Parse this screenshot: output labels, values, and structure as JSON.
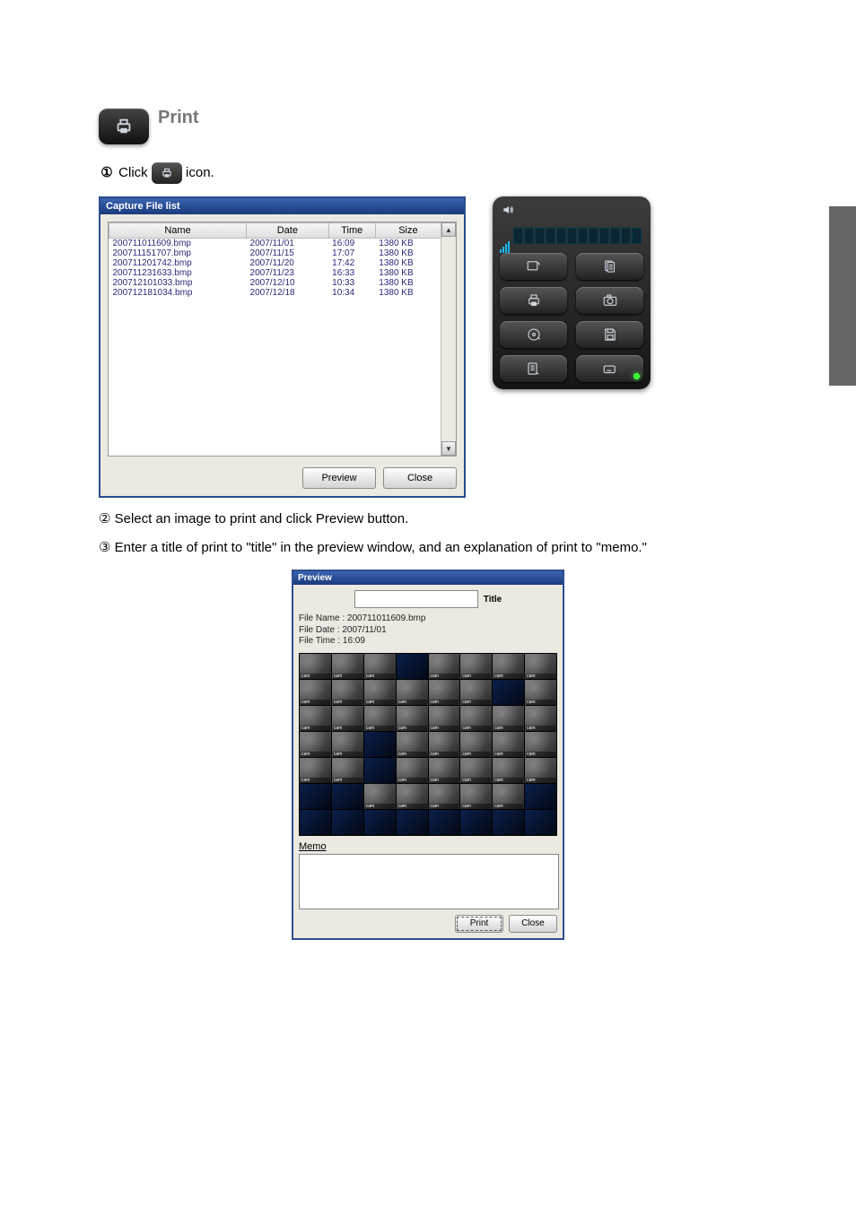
{
  "section": {
    "title": "Print"
  },
  "steps": {
    "s1_prefix": "①",
    "s1a": "Click",
    "s1b": "icon.",
    "s2": "② Select an image to print and click Preview button.",
    "s3": "③ Enter a title of print to \"title\" in the preview window, and an explanation of print to \"memo.\""
  },
  "capture_window": {
    "title": "Capture File list",
    "columns": [
      "Name",
      "Date",
      "Time",
      "Size"
    ],
    "rows": [
      {
        "name": "200711011609.bmp",
        "date": "2007/11/01",
        "time": "16:09",
        "size": "1380 KB"
      },
      {
        "name": "200711151707.bmp",
        "date": "2007/11/15",
        "time": "17:07",
        "size": "1380 KB"
      },
      {
        "name": "200711201742.bmp",
        "date": "2007/11/20",
        "time": "17:42",
        "size": "1380 KB"
      },
      {
        "name": "200711231633.bmp",
        "date": "2007/11/23",
        "time": "16:33",
        "size": "1380 KB"
      },
      {
        "name": "200712101033.bmp",
        "date": "2007/12/10",
        "time": "10:33",
        "size": "1380 KB"
      },
      {
        "name": "200712181034.bmp",
        "date": "2007/12/18",
        "time": "10:34",
        "size": "1380 KB"
      }
    ],
    "buttons": {
      "preview": "Preview",
      "close": "Close"
    }
  },
  "preview_window": {
    "title": "Preview",
    "title_field_label": "Title",
    "meta": {
      "file_name_label": "File Name :",
      "file_name": "200711011609.bmp",
      "file_date_label": "File Date :",
      "file_date": "2007/11/01",
      "file_time_label": "File Time :",
      "file_time": "16:09"
    },
    "memo_label": "Memo",
    "buttons": {
      "print": "Print",
      "close": "Close"
    }
  },
  "panel": {
    "icons": [
      "keypad",
      "filelist",
      "print",
      "camera",
      "disc",
      "save",
      "logs",
      "keyboard-info"
    ]
  }
}
